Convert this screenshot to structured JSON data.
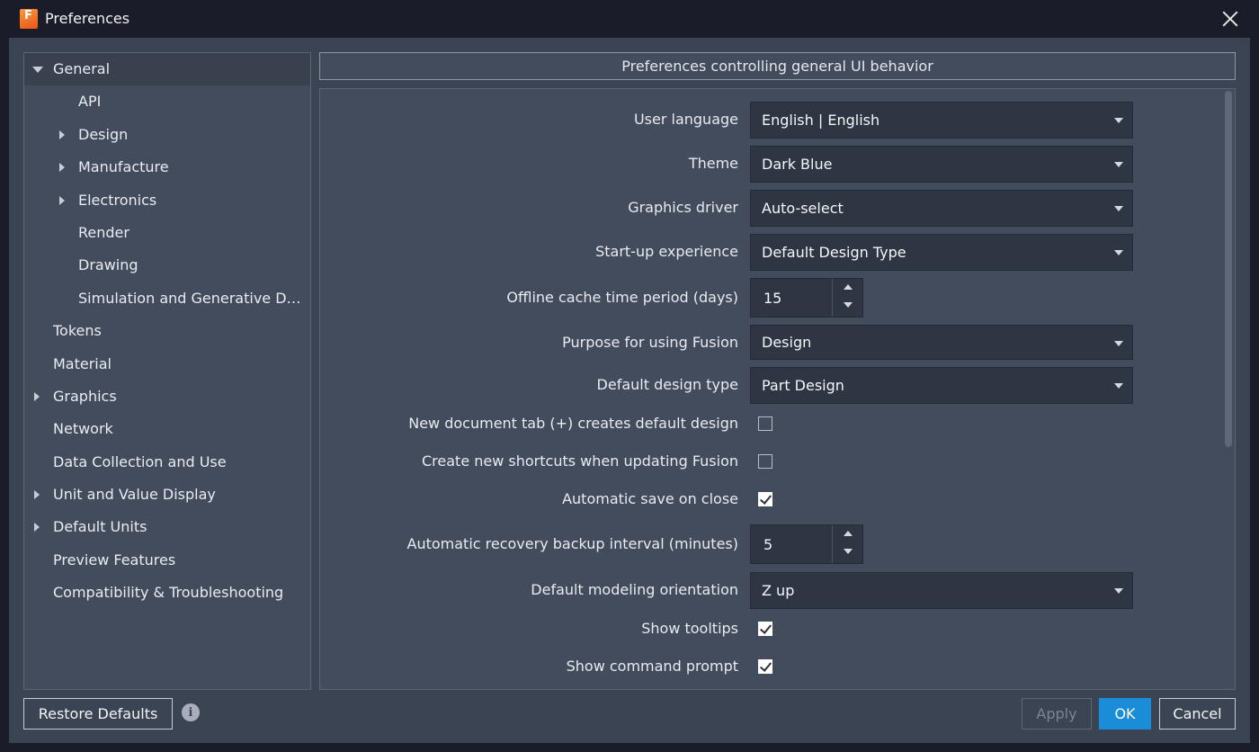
{
  "window": {
    "title": "Preferences",
    "logo_icon": "fusion-app-icon"
  },
  "sidebar": {
    "items": [
      {
        "label": "General",
        "level": 0,
        "arrow": "down",
        "selected": true
      },
      {
        "label": "API",
        "level": 1,
        "arrow": "none"
      },
      {
        "label": "Design",
        "level": 1,
        "arrow": "right"
      },
      {
        "label": "Manufacture",
        "level": 1,
        "arrow": "right"
      },
      {
        "label": "Electronics",
        "level": 1,
        "arrow": "right"
      },
      {
        "label": "Render",
        "level": 1,
        "arrow": "none"
      },
      {
        "label": "Drawing",
        "level": 1,
        "arrow": "none"
      },
      {
        "label": "Simulation and Generative De...",
        "level": 1,
        "arrow": "none"
      },
      {
        "label": "Tokens",
        "level": 0,
        "arrow": "none"
      },
      {
        "label": "Material",
        "level": 0,
        "arrow": "none"
      },
      {
        "label": "Graphics",
        "level": 0,
        "arrow": "right"
      },
      {
        "label": "Network",
        "level": 0,
        "arrow": "none"
      },
      {
        "label": "Data Collection and Use",
        "level": 0,
        "arrow": "none"
      },
      {
        "label": "Unit and Value Display",
        "level": 0,
        "arrow": "right"
      },
      {
        "label": "Default Units",
        "level": 0,
        "arrow": "right"
      },
      {
        "label": "Preview Features",
        "level": 0,
        "arrow": "none"
      },
      {
        "label": "Compatibility & Troubleshooting",
        "level": 0,
        "arrow": "none"
      }
    ]
  },
  "header": {
    "text": "Preferences controlling general UI behavior"
  },
  "settings": {
    "user_language": {
      "label": "User language",
      "value": "English | English"
    },
    "theme": {
      "label": "Theme",
      "value": "Dark Blue"
    },
    "graphics_driver": {
      "label": "Graphics driver",
      "value": "Auto-select"
    },
    "startup_experience": {
      "label": "Start-up experience",
      "value": "Default Design Type"
    },
    "offline_cache": {
      "label": "Offline cache time period (days)",
      "value": "15"
    },
    "purpose": {
      "label": "Purpose for using Fusion",
      "value": "Design"
    },
    "default_design_type": {
      "label": "Default design type",
      "value": "Part Design"
    },
    "new_doc_tab": {
      "label": "New document tab (+) creates default design",
      "checked": false
    },
    "create_shortcuts": {
      "label": "Create new shortcuts when updating Fusion",
      "checked": false
    },
    "auto_save_close": {
      "label": "Automatic save on close",
      "checked": true
    },
    "recovery_interval": {
      "label": "Automatic recovery backup interval (minutes)",
      "value": "5"
    },
    "modeling_orientation": {
      "label": "Default modeling orientation",
      "value": "Z up"
    },
    "show_tooltips": {
      "label": "Show tooltips",
      "checked": true
    },
    "show_command_prompt": {
      "label": "Show command prompt",
      "checked": true
    }
  },
  "footer": {
    "restore_label": "Restore Defaults",
    "info_icon": "i",
    "apply_label": "Apply",
    "ok_label": "OK",
    "cancel_label": "Cancel"
  },
  "colors": {
    "accent": "#1a8cd8",
    "background": "#3b4453",
    "panel": "#434c5d",
    "field": "#2f3643"
  }
}
